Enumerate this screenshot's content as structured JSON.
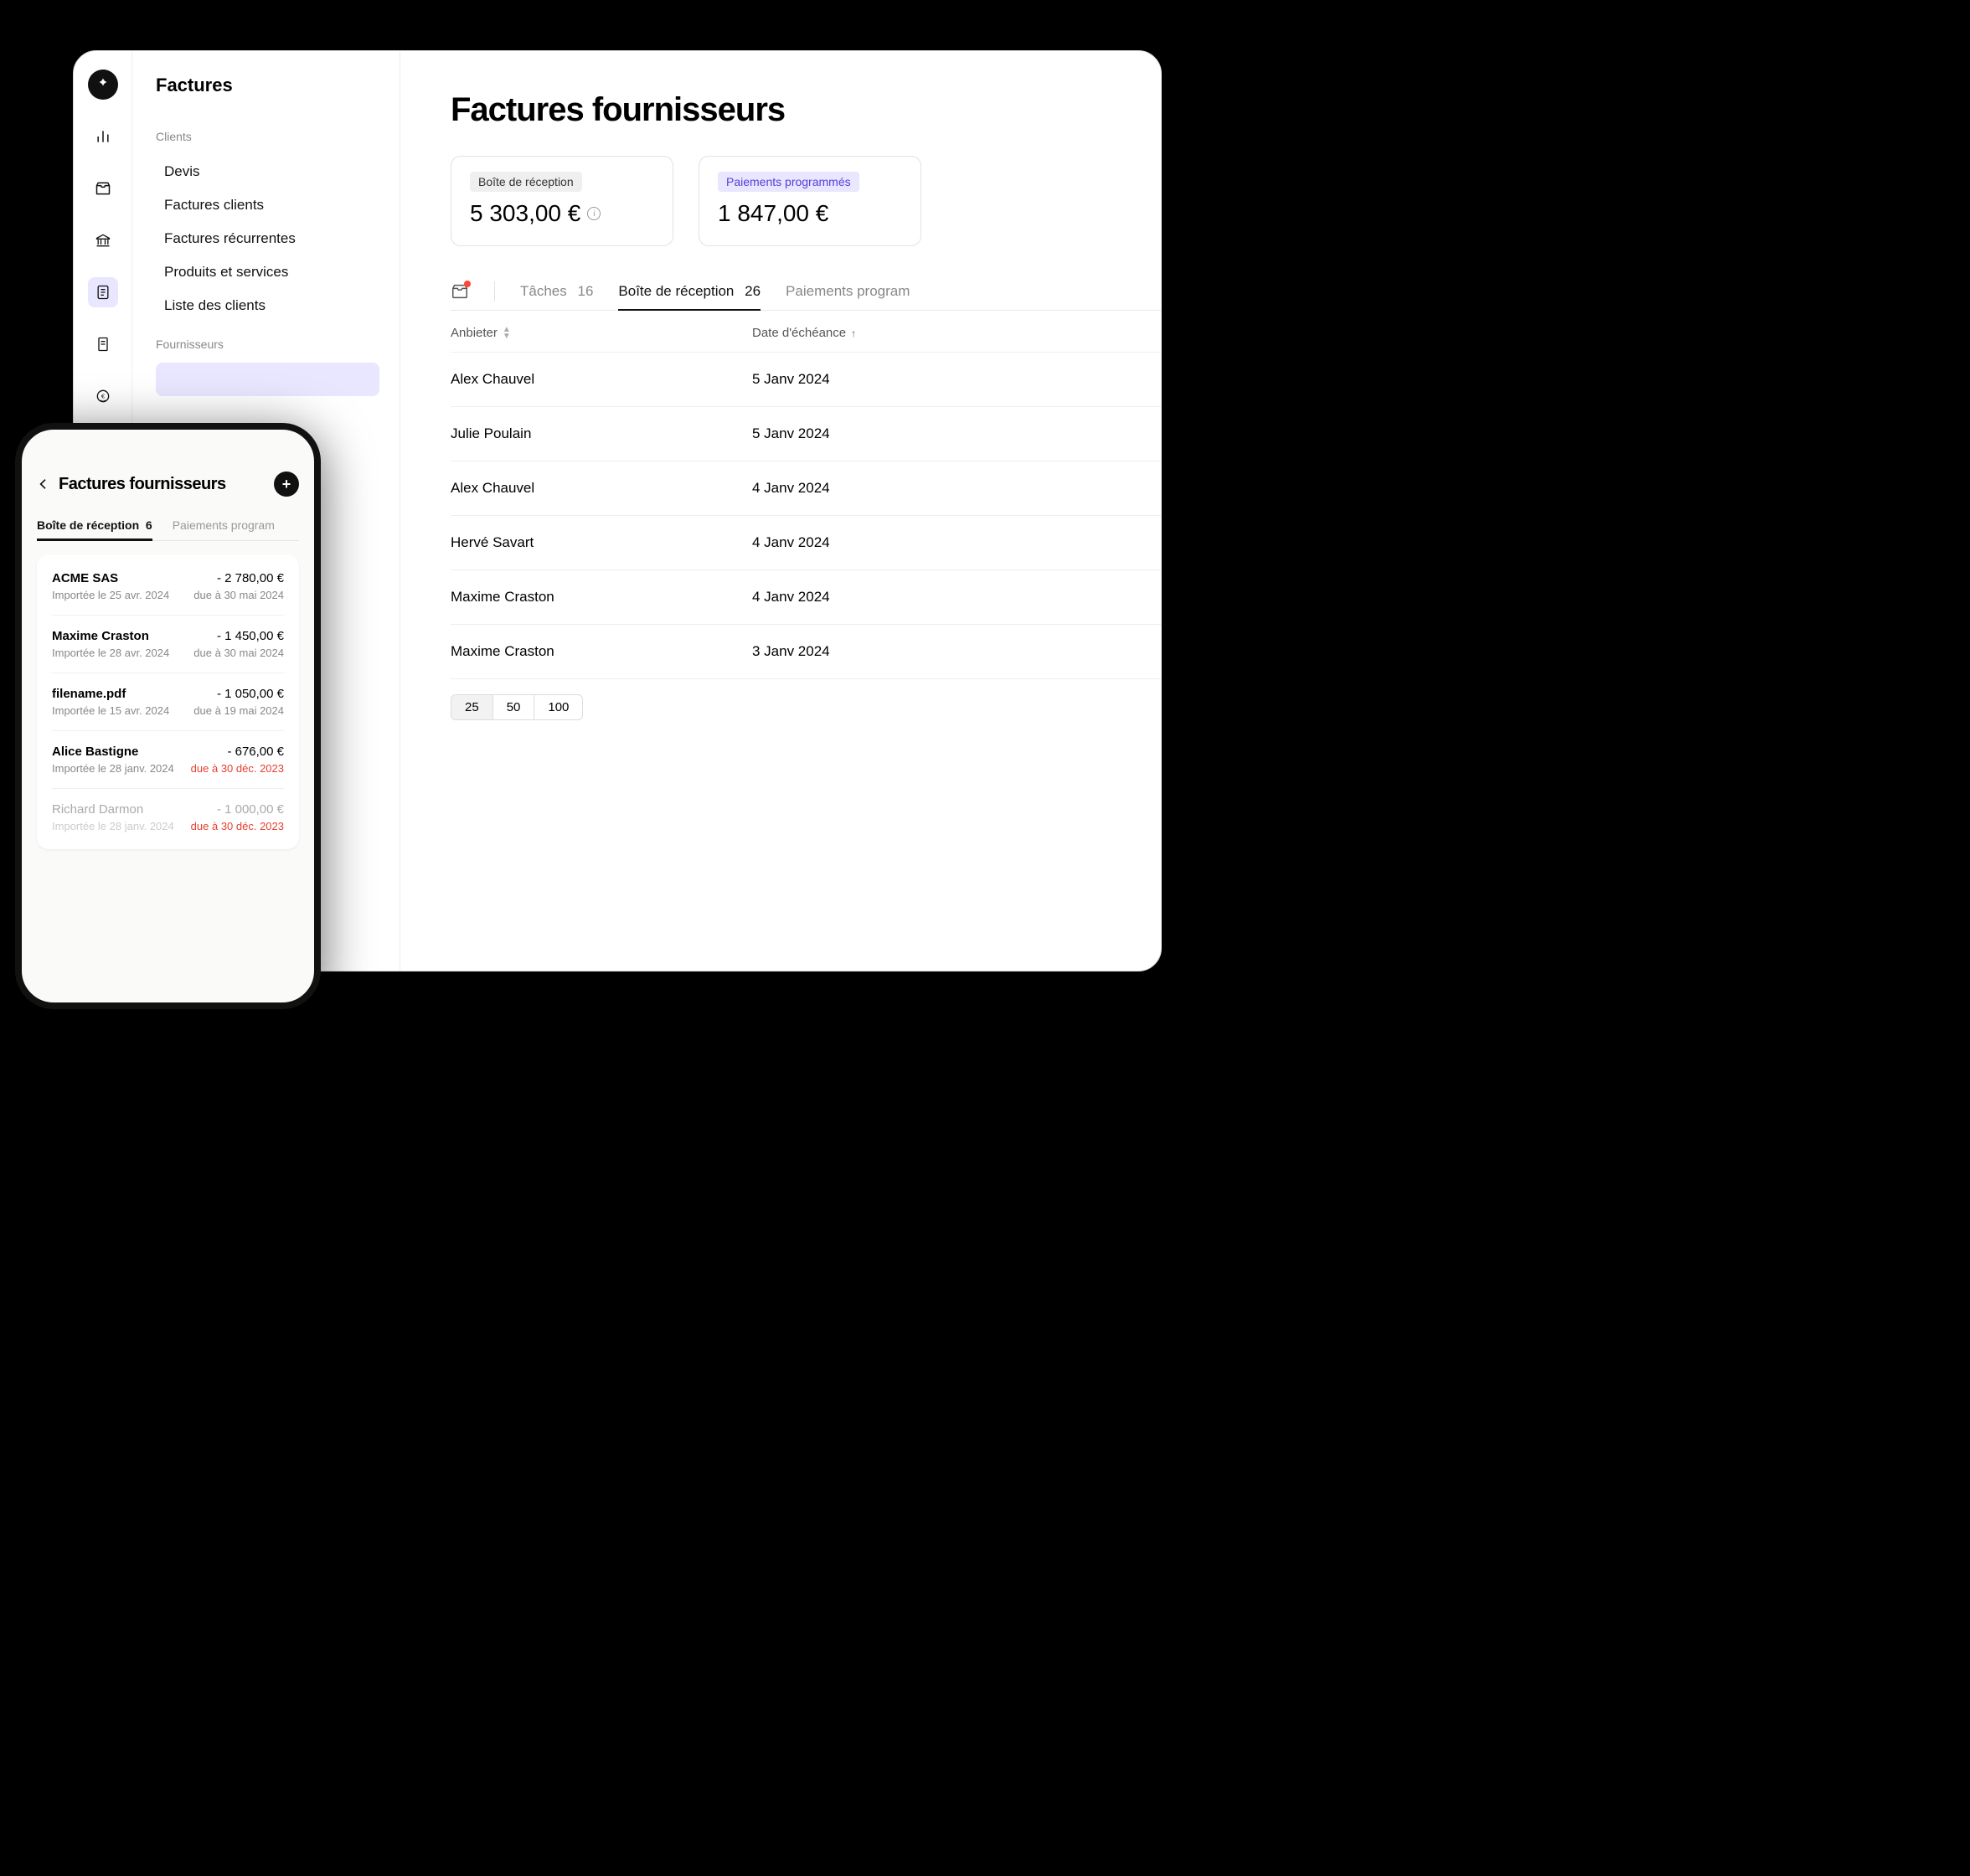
{
  "sidebar": {
    "title": "Factures",
    "clients": {
      "label": "Clients",
      "items": [
        "Devis",
        "Factures clients",
        "Factures récurrentes",
        "Produits et services",
        "Liste des clients"
      ]
    },
    "fournisseurs": {
      "label": "Fournisseurs"
    }
  },
  "main": {
    "title": "Factures fournisseurs",
    "cards": [
      {
        "label": "Boîte de réception",
        "amount": "5 303,00 €",
        "style": "gray",
        "info": true
      },
      {
        "label": "Paiements programmés",
        "amount": "1 847,00 €",
        "style": "purple",
        "info": false
      }
    ],
    "tabs": {
      "tasks": {
        "label": "Tâches",
        "count": "16"
      },
      "inbox": {
        "label": "Boîte de réception",
        "count": "26"
      },
      "scheduled": {
        "label": "Paiements program"
      }
    },
    "columns": {
      "provider": "Anbieter",
      "due": "Date d'échéance"
    },
    "rows": [
      {
        "provider": "Alex Chauvel",
        "due": "5 Janv 2024"
      },
      {
        "provider": "Julie Poulain",
        "due": "5 Janv 2024"
      },
      {
        "provider": "Alex Chauvel",
        "due": "4 Janv 2024"
      },
      {
        "provider": "Hervé Savart",
        "due": "4 Janv 2024"
      },
      {
        "provider": "Maxime Craston",
        "due": "4 Janv 2024"
      },
      {
        "provider": "Maxime Craston",
        "due": "3 Janv 2024"
      }
    ],
    "pagination": [
      "25",
      "50",
      "100"
    ]
  },
  "phone": {
    "title": "Factures fournisseurs",
    "tabs": {
      "inbox": {
        "label": "Boîte de réception",
        "count": "6"
      },
      "scheduled": {
        "label": "Paiements program"
      }
    },
    "items": [
      {
        "name": "ACME SAS",
        "amount": "- 2 780,00 €",
        "imported": "Importée le 25 avr. 2024",
        "due": "due à 30 mai 2024",
        "overdue": false
      },
      {
        "name": "Maxime Craston",
        "amount": "- 1 450,00 €",
        "imported": "Importée le 28 avr. 2024",
        "due": "due à 30 mai 2024",
        "overdue": false
      },
      {
        "name": "filename.pdf",
        "amount": "- 1 050,00 €",
        "imported": "Importée le 15 avr. 2024",
        "due": "due à 19 mai 2024",
        "overdue": false
      },
      {
        "name": "Alice Bastigne",
        "amount": "- 676,00 €",
        "imported": "Importée le 28 janv. 2024",
        "due": "due à 30 déc. 2023",
        "overdue": true
      },
      {
        "name": "Richard Darmon",
        "amount": "- 1 000,00 €",
        "imported": "Importée le 28 janv. 2024",
        "due": "due à 30 déc. 2023",
        "overdue": true,
        "faded": true
      }
    ]
  }
}
